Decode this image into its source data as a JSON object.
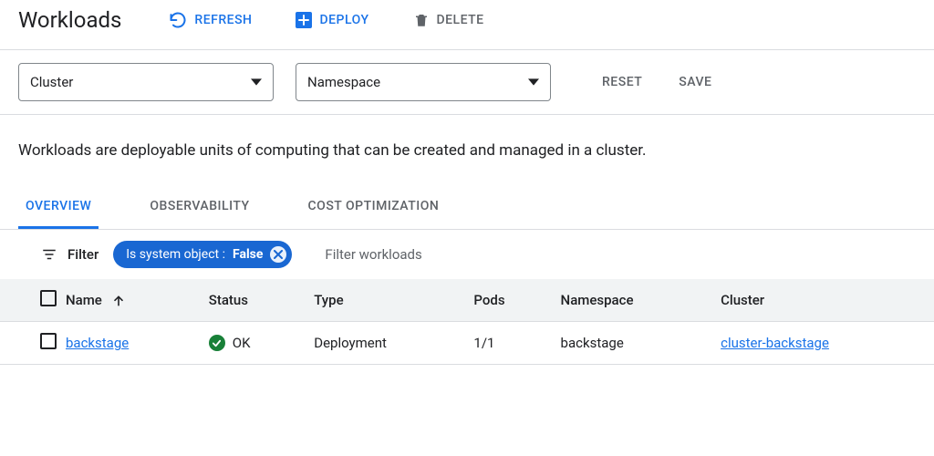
{
  "header": {
    "title": "Workloads",
    "actions": {
      "refresh": "REFRESH",
      "deploy": "DEPLOY",
      "delete": "DELETE"
    }
  },
  "filters": {
    "cluster_label": "Cluster",
    "namespace_label": "Namespace",
    "reset": "RESET",
    "save": "SAVE"
  },
  "description": "Workloads are deployable units of computing that can be created and managed in a cluster.",
  "tabs": [
    {
      "label": "OVERVIEW",
      "active": true
    },
    {
      "label": "OBSERVABILITY",
      "active": false
    },
    {
      "label": "COST OPTIMIZATION",
      "active": false
    }
  ],
  "table_filter": {
    "label": "Filter",
    "chip_key": "Is system object",
    "chip_val": "False",
    "placeholder": "Filter workloads"
  },
  "columns": {
    "name": "Name",
    "status": "Status",
    "type": "Type",
    "pods": "Pods",
    "namespace": "Namespace",
    "cluster": "Cluster"
  },
  "rows": [
    {
      "name": "backstage",
      "status": "OK",
      "type": "Deployment",
      "pods": "1/1",
      "namespace": "backstage",
      "cluster": "cluster-backstage"
    }
  ]
}
